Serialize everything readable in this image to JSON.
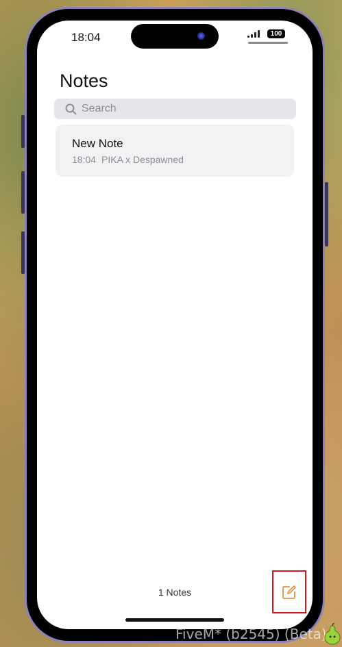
{
  "status_bar": {
    "time": "18:04",
    "battery": "100"
  },
  "notes_app": {
    "title": "Notes",
    "search_placeholder": "Search",
    "notes": [
      {
        "title": "New Note",
        "time": "18:04",
        "preview": "PIKA x Despawned"
      }
    ],
    "count_label": "1 Notes",
    "accent_color": "#e8923a"
  },
  "overlay": {
    "watermark": "FiveM* (b2545) (Beta)"
  },
  "icons": [
    "search-icon",
    "compose-icon",
    "pear-icon"
  ]
}
